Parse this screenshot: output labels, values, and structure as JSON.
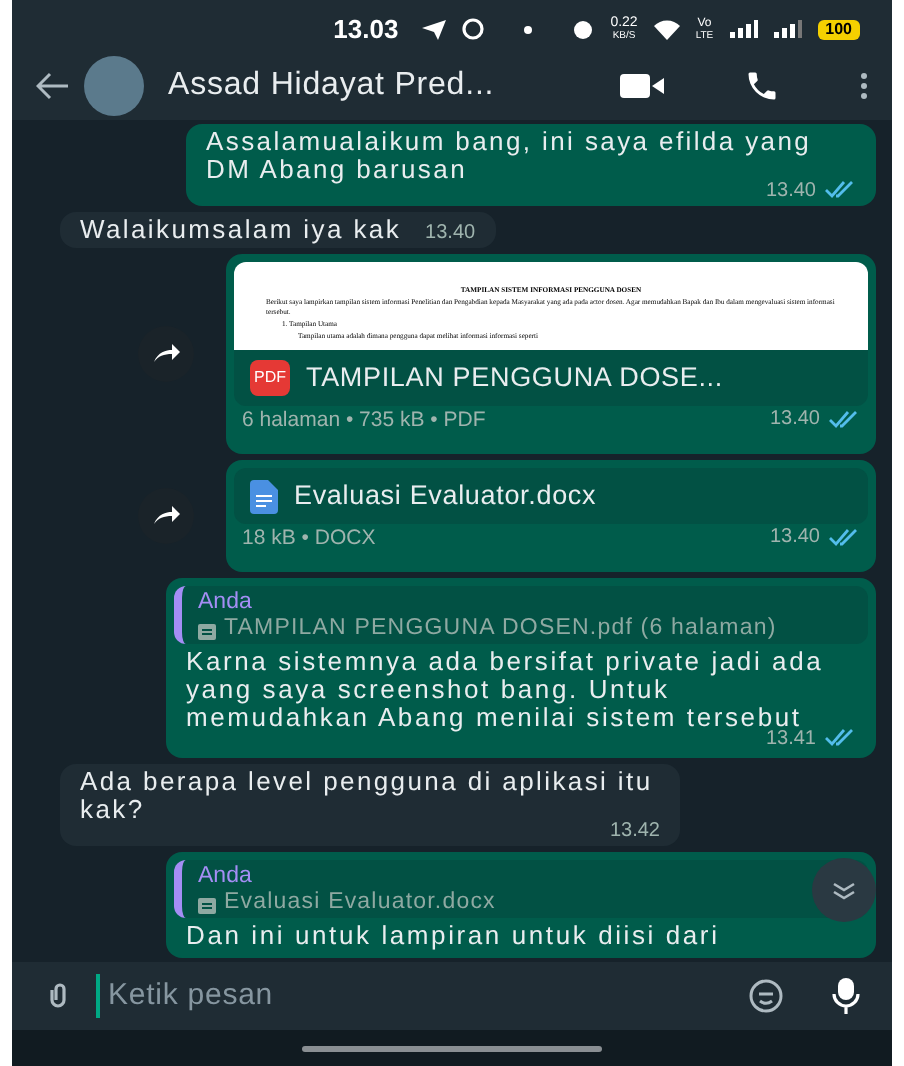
{
  "status_bar": {
    "time": "13.03",
    "net_speed": "0.22",
    "net_unit": "KB/S",
    "network": "Vo",
    "network_type": "LTE",
    "battery": "100"
  },
  "header": {
    "contact_name": "Assad Hidayat Pred..."
  },
  "messages": [
    {
      "kind": "text",
      "outgoing": true,
      "text": "Assalamualaikum bang, ini saya efilda yang DM Abang barusan",
      "time": "13.40",
      "read": true
    },
    {
      "kind": "text",
      "outgoing": false,
      "text": "Walaikumsalam iya kak",
      "time": "13.40"
    },
    {
      "kind": "pdf",
      "outgoing": true,
      "preview": {
        "title": "TAMPILAN SISTEM INFORMASI PENGGUNA DOSEN",
        "paragraph": "Berikut saya lampirkan tampilan sistem informasi Penelitian dan Pengabdian kepada Masyarakat yang ada pada actor dosen. Agar memudahkan Bapak dan Ibu dalam mengevaluasi sistem informasi tersebut.",
        "list_item": "1.   Tampilan Utama",
        "list_text": "Tampilan utama adalah dimana pengguna dapat melihat informasi informasi seperti"
      },
      "file_type_badge": "PDF",
      "file_name": "TAMPILAN PENGGUNA DOSE...",
      "meta": "6 halaman • 735 kB • PDF",
      "time": "13.40",
      "read": true
    },
    {
      "kind": "doc",
      "outgoing": true,
      "file_name": "Evaluasi Evaluator.docx",
      "meta": "18 kB • DOCX",
      "time": "13.40",
      "read": true
    },
    {
      "kind": "reply",
      "outgoing": true,
      "quoted_author": "Anda",
      "quoted_text": "TAMPILAN PENGGUNA DOSEN.pdf (6 halaman)",
      "text": "Karna sistemnya ada bersifat private jadi ada yang saya screenshot bang. Untuk memudahkan Abang menilai sistem tersebut",
      "time": "13.41",
      "read": true
    },
    {
      "kind": "text",
      "outgoing": false,
      "text": "Ada berapa level pengguna di aplikasi itu kak?",
      "time": "13.42"
    },
    {
      "kind": "reply",
      "outgoing": true,
      "quoted_author": "Anda",
      "quoted_text": "Evaluasi Evaluator.docx",
      "text": "Dan ini untuk lampiran untuk diisi dari"
    }
  ],
  "composer": {
    "placeholder": "Ketik pesan"
  }
}
